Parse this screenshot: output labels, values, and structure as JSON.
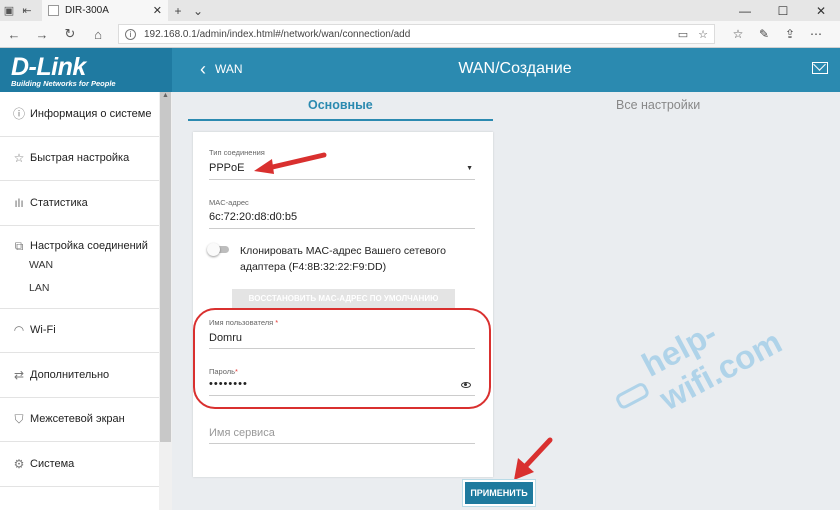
{
  "browser": {
    "tab_title": "DIR-300A",
    "new_tab": "+",
    "tab_list": "⌄",
    "url": "192.168.0.1/admin/index.html#/network/wan/connection/add"
  },
  "app": {
    "logo": "D-Link",
    "tagline": "Building Networks for People",
    "back_label": "WAN",
    "page_title": "WAN/Создание"
  },
  "sidebar": {
    "items": [
      {
        "label": "Информация о системе",
        "icon": "info-icon"
      },
      {
        "label": "Быстрая настройка",
        "icon": "star-icon"
      },
      {
        "label": "Статистика",
        "icon": "bar-chart-icon"
      },
      {
        "label": "Настройка соединений",
        "icon": "network-icon",
        "subitems": [
          "WAN",
          "LAN"
        ]
      },
      {
        "label": "Wi-Fi",
        "icon": "wifi-icon"
      },
      {
        "label": "Дополнительно",
        "icon": "arrows-icon"
      },
      {
        "label": "Межсетевой экран",
        "icon": "shield-icon"
      },
      {
        "label": "Система",
        "icon": "gear-icon"
      }
    ]
  },
  "tabs": {
    "basic": "Основные",
    "all": "Все настройки"
  },
  "form": {
    "conn_type_label": "Тип соединения",
    "conn_type_value": "PPPoE",
    "mac_label": "MAC-адрес",
    "mac_value": "6c:72:20:d8:d0:b5",
    "clone_label": "Клонировать MAC-адрес Вашего сетевого адаптера (F4:8B:32:22:F9:DD)",
    "restore_button": "ВОССТАНОВИТЬ MAC-АДРЕС ПО УМОЛЧАНИЮ",
    "username_label": "Имя пользователя",
    "username_value": "Domru",
    "password_label": "Пароль",
    "password_value": "••••••••",
    "service_placeholder": "Имя сервиса",
    "required_mark": "*",
    "apply_button": "ПРИМЕНИТЬ"
  },
  "watermark": "help-wifi.com",
  "colors": {
    "header": "#2b8ab0",
    "logo_bg": "#1f7aa1",
    "accent": "#2b8ab0",
    "highlight_red": "#d9302f"
  }
}
